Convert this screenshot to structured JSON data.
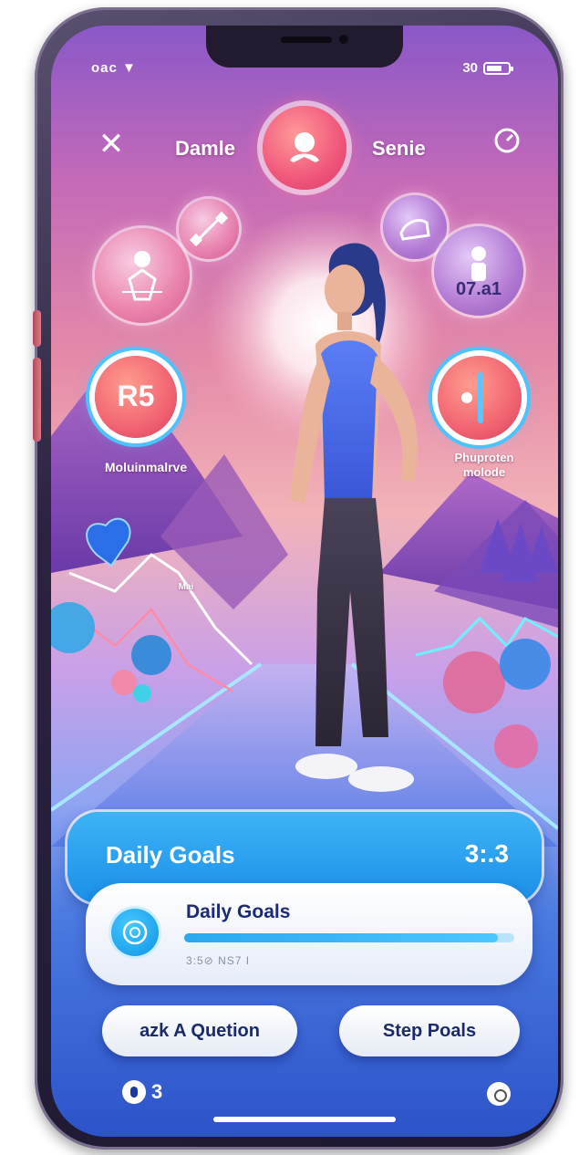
{
  "status_bar": {
    "carrier": "oac",
    "battery_label": "30"
  },
  "header": {
    "left_label": "Damle",
    "right_label": "Senie"
  },
  "metrics": {
    "top_right_bubble": "07.a1",
    "left_ring_value": "R5",
    "left_caption": "Moluinmalrve",
    "right_caption": "Phuproten molode",
    "chart_label": "Mai"
  },
  "goals_card": {
    "title": "Daily Goals",
    "count": "3:.3"
  },
  "progress_card": {
    "label": "Daily Goals",
    "subtext": "3:5⊘ NS7 I",
    "progress": 0.95
  },
  "buttons": {
    "ask": "azk A Quetion",
    "step": "Step Poals"
  },
  "bottom_bar": {
    "left_value": "3"
  },
  "colors": {
    "accent": "#1a8fe8",
    "primary_text": "#1b2a7a",
    "avatar": "#f0567a"
  }
}
